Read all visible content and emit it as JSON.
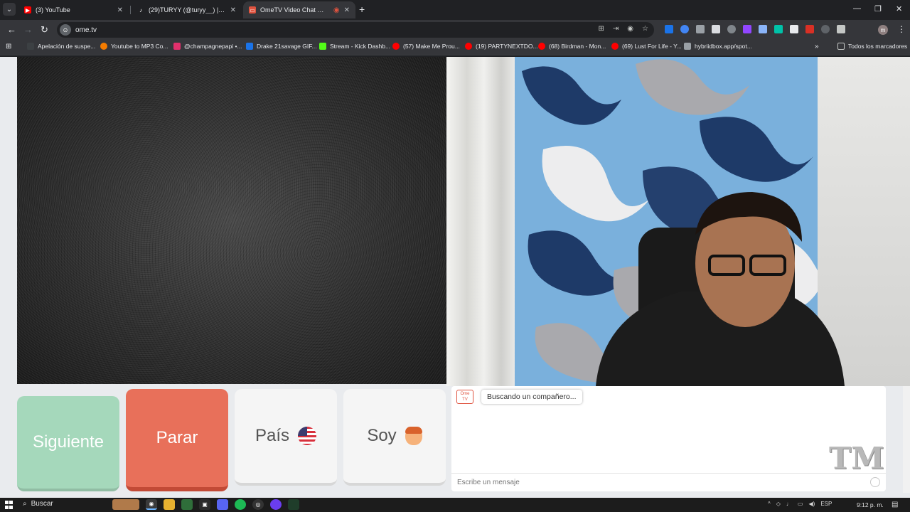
{
  "browser": {
    "tabs": [
      {
        "title": "(3) YouTube",
        "icon": "youtube-icon",
        "active": false
      },
      {
        "title": "(29)TURYY (@turyy__) | TikTok",
        "icon": "tiktok-icon",
        "active": false
      },
      {
        "title": "OmeTV Video Chat — Ome",
        "icon": "ometv-icon",
        "active": true
      }
    ],
    "url": "ome.tv"
  },
  "bookmarks": [
    {
      "label": "Apelación de suspe..."
    },
    {
      "label": "Youtube to MP3 Co..."
    },
    {
      "label": "@champagnepapi •..."
    },
    {
      "label": "Drake 21savage GIF..."
    },
    {
      "label": "Stream - Kick Dashb..."
    },
    {
      "label": "(57) Make Me Prou..."
    },
    {
      "label": "(19) PARTYNEXTDO..."
    },
    {
      "label": "(68) Birdman - Mon..."
    },
    {
      "label": "(69) Lust For Life - Y..."
    },
    {
      "label": "hybriidbox.app/spot..."
    }
  ],
  "bookmarks_folder": "Todos los marcadores",
  "controls": {
    "next_label": "Siguiente",
    "stop_label": "Parar",
    "country_label": "País",
    "gender_label": "Soy"
  },
  "chat": {
    "logo": "Ome TV",
    "status": "Buscando un compañero...",
    "input_placeholder": "Escribe un mensaje"
  },
  "taskbar": {
    "search_label": "Buscar",
    "language": "ESP",
    "time": "9:12 p. m."
  },
  "colors": {
    "next_button": "#a5d8bb",
    "stop_button": "#e8705a",
    "tab_active": "#35363a",
    "browser_frame": "#202124"
  }
}
